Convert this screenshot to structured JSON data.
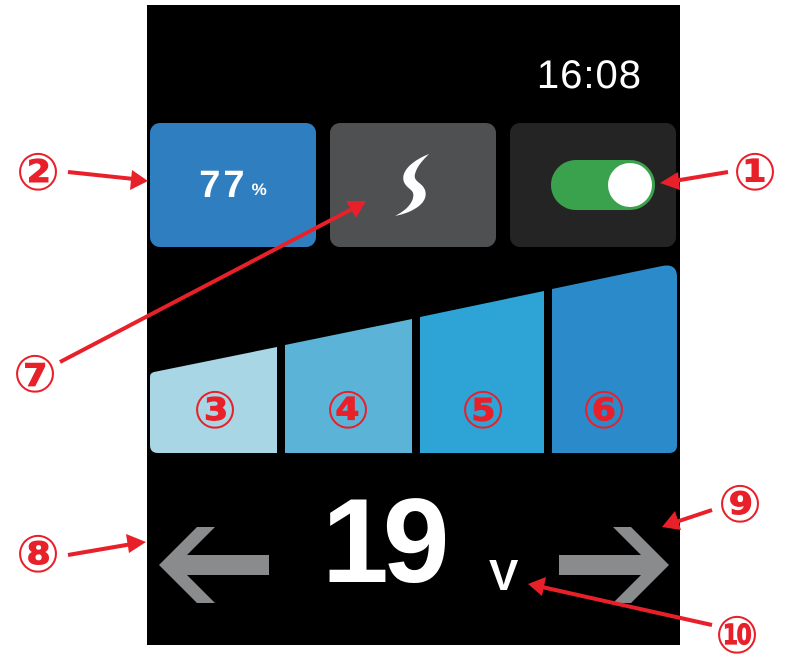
{
  "status_bar": {
    "time": "16:08"
  },
  "battery": {
    "value": "77",
    "unit": "%"
  },
  "boost_icon": "lightning-bolt-icon",
  "power_toggle": {
    "state": "on",
    "color": "#3aa24d"
  },
  "output_levels": [
    {
      "label": "③",
      "color": "#a8d6e4"
    },
    {
      "label": "④",
      "color": "#5bb4d8"
    },
    {
      "label": "⑤",
      "color": "#2ea4d6"
    },
    {
      "label": "⑥",
      "color": "#2b8bca"
    }
  ],
  "voltage": {
    "value": "19",
    "unit": "V"
  },
  "nav": {
    "prev_icon": "arrow-left-icon",
    "next_icon": "arrow-right-icon"
  },
  "callouts": [
    {
      "label": "①",
      "target": "power-toggle"
    },
    {
      "label": "②",
      "target": "battery-tile"
    },
    {
      "label": "⑦",
      "target": "boost-tile"
    },
    {
      "label": "⑧",
      "target": "prev-arrow"
    },
    {
      "label": "⑨",
      "target": "next-arrow"
    },
    {
      "label": "⑩",
      "target": "voltage-unit"
    }
  ],
  "colors": {
    "callout": "#e8202a",
    "screen_bg": "#000000",
    "arrow": "#8a8b8d"
  }
}
